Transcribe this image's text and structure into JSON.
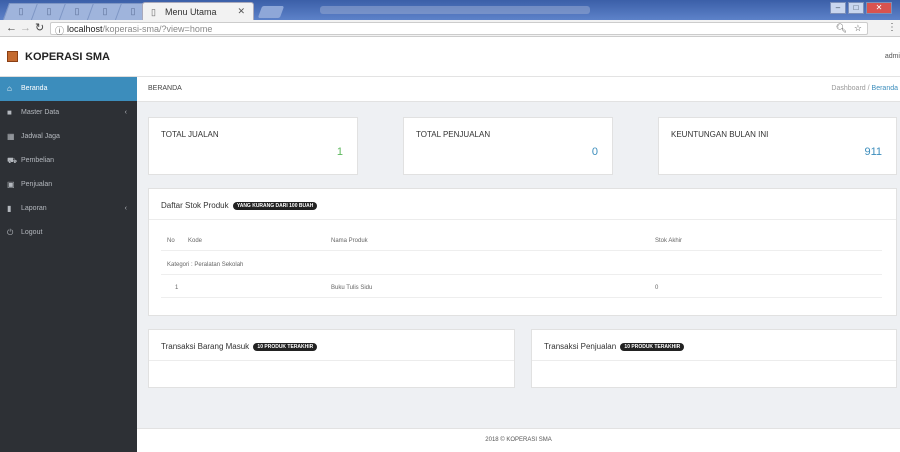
{
  "browser": {
    "tab_title": "Menu Utama",
    "url_host": "localhost",
    "url_path": "/koperasi-sma/?view=home"
  },
  "app": {
    "brand": "KOPERASI SMA",
    "user": "admi"
  },
  "sidebar": {
    "items": [
      {
        "label": "Beranda",
        "icon": "home-icon"
      },
      {
        "label": "Master Data",
        "icon": "folder-icon",
        "has_arrow": true
      },
      {
        "label": "Jadwal Jaga",
        "icon": "calendar-icon"
      },
      {
        "label": "Pembelian",
        "icon": "cart-icon"
      },
      {
        "label": "Penjualan",
        "icon": "cash-icon"
      },
      {
        "label": "Laporan",
        "icon": "file-icon",
        "has_arrow": true
      },
      {
        "label": "Logout",
        "icon": "power-icon"
      }
    ]
  },
  "header": {
    "title": "BERANDA",
    "breadcrumb_root": "Dashboard",
    "breadcrumb_sep": "/",
    "breadcrumb_current": "Beranda"
  },
  "stats": [
    {
      "label": "TOTAL JUALAN",
      "value": "1",
      "color": "#5cb85c"
    },
    {
      "label": "TOTAL PENJUALAN",
      "value": "0",
      "color": "#3c8dbc"
    },
    {
      "label": "KEUNTUNGAN BULAN INI",
      "value": "911",
      "color": "#3c8dbc"
    }
  ],
  "stock": {
    "title": "Daftar Stok Produk",
    "badge": "YANG KURANG DARI 100 BUAH",
    "columns": [
      "No",
      "Kode",
      "Nama Produk",
      "Stok Akhir"
    ],
    "category": "Kategori : Peralatan Sekolah",
    "rows": [
      {
        "no": "1",
        "kode": "",
        "nama": "Buku Tulis Sidu",
        "stok": "0"
      }
    ]
  },
  "masuk": {
    "title": "Transaksi Barang Masuk",
    "badge": "10 PRODUK TERAKHIR"
  },
  "penjualan": {
    "title": "Transaksi Penjualan",
    "badge": "10 PRODUK TERAKHIR"
  },
  "footer": {
    "text": "2018 © KOPERASI SMA"
  },
  "colors": {
    "accent": "#3c8dbc",
    "sidebar": "#2d3035"
  }
}
